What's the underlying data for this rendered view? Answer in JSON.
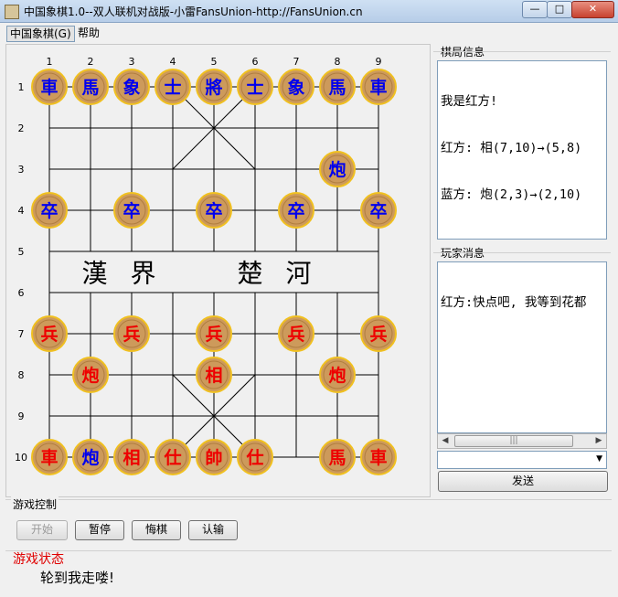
{
  "window": {
    "title": "中国象棋1.0--双人联机对战版-小雷FansUnion-http://FansUnion.cn",
    "min_label": "—",
    "max_label": "□",
    "close_label": "✕"
  },
  "menubar": {
    "game": "中国象棋(G)",
    "help": "帮助"
  },
  "board": {
    "col_labels": [
      "1",
      "2",
      "3",
      "4",
      "5",
      "6",
      "7",
      "8",
      "9"
    ],
    "row_labels": [
      "1",
      "2",
      "3",
      "4",
      "5",
      "6",
      "7",
      "8",
      "9",
      "10"
    ],
    "river_left": "漢 界",
    "river_right": "楚 河",
    "colors": {
      "blue_piece_text": "#0000ee",
      "red_piece_text": "#ee0000",
      "piece_fill": "#cd9a5b",
      "piece_ring": "#f0c020"
    },
    "pieces": [
      {
        "text": "車",
        "col": 1,
        "row": 1,
        "side": "blue"
      },
      {
        "text": "馬",
        "col": 2,
        "row": 1,
        "side": "blue"
      },
      {
        "text": "象",
        "col": 3,
        "row": 1,
        "side": "blue"
      },
      {
        "text": "士",
        "col": 4,
        "row": 1,
        "side": "blue"
      },
      {
        "text": "將",
        "col": 5,
        "row": 1,
        "side": "blue"
      },
      {
        "text": "士",
        "col": 6,
        "row": 1,
        "side": "blue"
      },
      {
        "text": "象",
        "col": 7,
        "row": 1,
        "side": "blue"
      },
      {
        "text": "馬",
        "col": 8,
        "row": 1,
        "side": "blue"
      },
      {
        "text": "車",
        "col": 9,
        "row": 1,
        "side": "blue"
      },
      {
        "text": "炮",
        "col": 8,
        "row": 3,
        "side": "blue"
      },
      {
        "text": "卒",
        "col": 1,
        "row": 4,
        "side": "blue"
      },
      {
        "text": "卒",
        "col": 3,
        "row": 4,
        "side": "blue"
      },
      {
        "text": "卒",
        "col": 5,
        "row": 4,
        "side": "blue"
      },
      {
        "text": "卒",
        "col": 7,
        "row": 4,
        "side": "blue"
      },
      {
        "text": "卒",
        "col": 9,
        "row": 4,
        "side": "blue"
      },
      {
        "text": "兵",
        "col": 1,
        "row": 7,
        "side": "red"
      },
      {
        "text": "兵",
        "col": 3,
        "row": 7,
        "side": "red"
      },
      {
        "text": "兵",
        "col": 5,
        "row": 7,
        "side": "red"
      },
      {
        "text": "兵",
        "col": 7,
        "row": 7,
        "side": "red"
      },
      {
        "text": "兵",
        "col": 9,
        "row": 7,
        "side": "red"
      },
      {
        "text": "炮",
        "col": 2,
        "row": 8,
        "side": "red"
      },
      {
        "text": "相",
        "col": 5,
        "row": 8,
        "side": "red"
      },
      {
        "text": "炮",
        "col": 8,
        "row": 8,
        "side": "red"
      },
      {
        "text": "車",
        "col": 1,
        "row": 10,
        "side": "red"
      },
      {
        "text": "炮",
        "col": 2,
        "row": 10,
        "side": "blue"
      },
      {
        "text": "相",
        "col": 3,
        "row": 10,
        "side": "red"
      },
      {
        "text": "仕",
        "col": 4,
        "row": 10,
        "side": "red"
      },
      {
        "text": "帥",
        "col": 5,
        "row": 10,
        "side": "red"
      },
      {
        "text": "仕",
        "col": 6,
        "row": 10,
        "side": "red"
      },
      {
        "text": "馬",
        "col": 8,
        "row": 10,
        "side": "red"
      },
      {
        "text": "車",
        "col": 9,
        "row": 10,
        "side": "red"
      }
    ]
  },
  "info_panel": {
    "title": "棋局信息",
    "lines": [
      "我是红方!",
      "红方: 相(7,10)→(5,8)",
      "蓝方: 炮(2,3)→(2,10)"
    ]
  },
  "chat_panel": {
    "title": "玩家消息",
    "lines": [
      "红方:快点吧, 我等到花都"
    ],
    "send_label": "发送",
    "scroll_left": "◀",
    "scroll_right": "▶",
    "scroll_grip": "|||",
    "dropdown_arrow": "▼"
  },
  "control": {
    "title": "游戏控制",
    "start": "开始",
    "pause": "暂停",
    "undo": "悔棋",
    "resign": "认输"
  },
  "status": {
    "title": "游戏状态",
    "text": "轮到我走喽!"
  }
}
